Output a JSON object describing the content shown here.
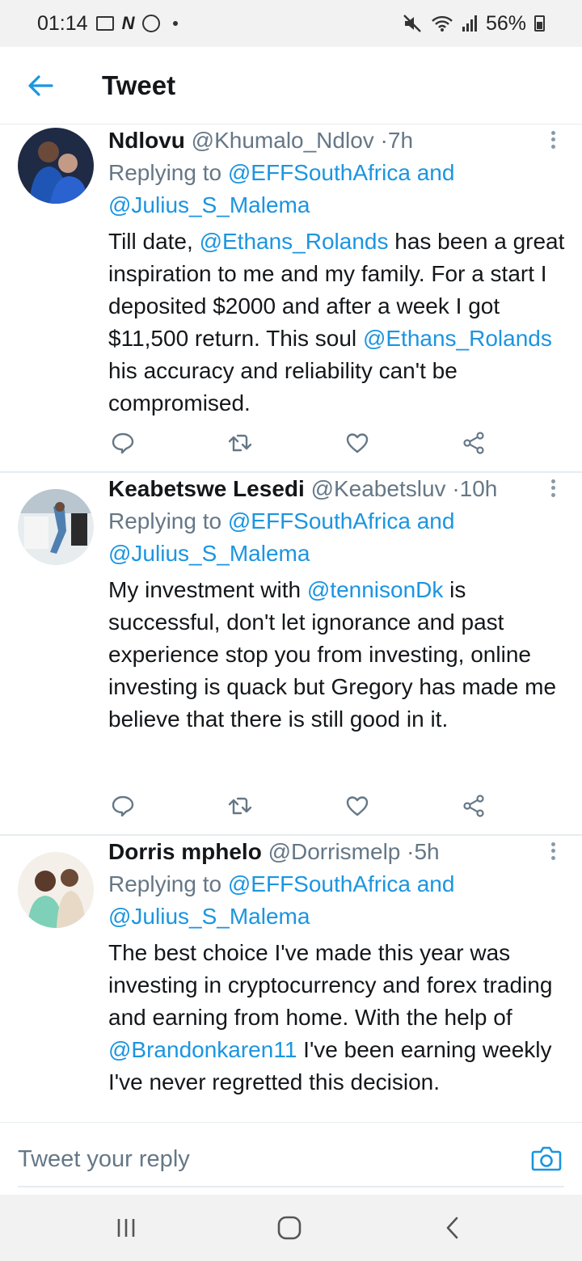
{
  "status_bar": {
    "time": "01:14",
    "battery": "56%",
    "left_icons": [
      "gallery-icon",
      "netflix-icon",
      "whatsapp-icon",
      "dot-icon"
    ],
    "right_icons": [
      "mute-icon",
      "wifi-icon",
      "signal-icon",
      "battery-icon"
    ]
  },
  "header": {
    "title": "Tweet",
    "back_icon": "arrow-left-icon"
  },
  "colors": {
    "accent": "#1b95e0",
    "text": "#14171a",
    "muted": "#657786",
    "divider": "#e6ecf0",
    "system_bar": "#f2f2f2"
  },
  "tweets": [
    {
      "name": "Ndlovu",
      "handle": "@Khumalo_Ndlov",
      "sep": "·",
      "time": "7h",
      "replying_prefix": "Replying to",
      "replying_to_1": "@EFFSouthAfrica",
      "replying_and": "and",
      "replying_to_2": "@Julius_S_Malema",
      "text": [
        {
          "t": "Till date, "
        },
        {
          "t": "@Ethans_Rolands",
          "link": true
        },
        {
          "t": " has been a great inspiration to me and my family. For a start I deposited $2000 and after a week I got $11,500 return. This soul "
        },
        {
          "t": "@Ethans_Rolands",
          "link": true
        },
        {
          "t": " his accuracy and reliability can't be compromised."
        }
      ]
    },
    {
      "name": "Keabetswe Lesedi",
      "handle": "@Keabetsluv",
      "sep": "·",
      "time": "10h",
      "replying_prefix": "Replying to",
      "replying_to_1": "@EFFSouthAfrica",
      "replying_and": "and",
      "replying_to_2": "@Julius_S_Malema",
      "text": [
        {
          "t": "My investment with "
        },
        {
          "t": "@tennisonDk",
          "link": true
        },
        {
          "t": " is successful, don't let ignorance and past experience stop you from investing, online investing is quack but Gregory has made me believe that there is still good in it."
        }
      ]
    },
    {
      "name": "Dorris mphelo",
      "handle": "@Dorrismelp",
      "sep": "·",
      "time": "5h",
      "replying_prefix": "Replying to",
      "replying_to_1": "@EFFSouthAfrica",
      "replying_and": "and",
      "replying_to_2": "@Julius_S_Malema",
      "text": [
        {
          "t": "The best choice I've made this year was investing in cryptocurrency and forex trading and earning from home. With the help of "
        },
        {
          "t": "@Brandonkaren11",
          "link": true
        },
        {
          "t": " I've been earning weekly I've never  regretted this decision."
        }
      ]
    }
  ],
  "tweet_actions": [
    "reply-icon",
    "retweet-icon",
    "like-icon",
    "share-icon"
  ],
  "reply_bar": {
    "placeholder": "Tweet your reply",
    "camera_icon": "camera-icon"
  },
  "nav_bar": [
    "recent-apps-icon",
    "home-icon",
    "back-icon"
  ]
}
